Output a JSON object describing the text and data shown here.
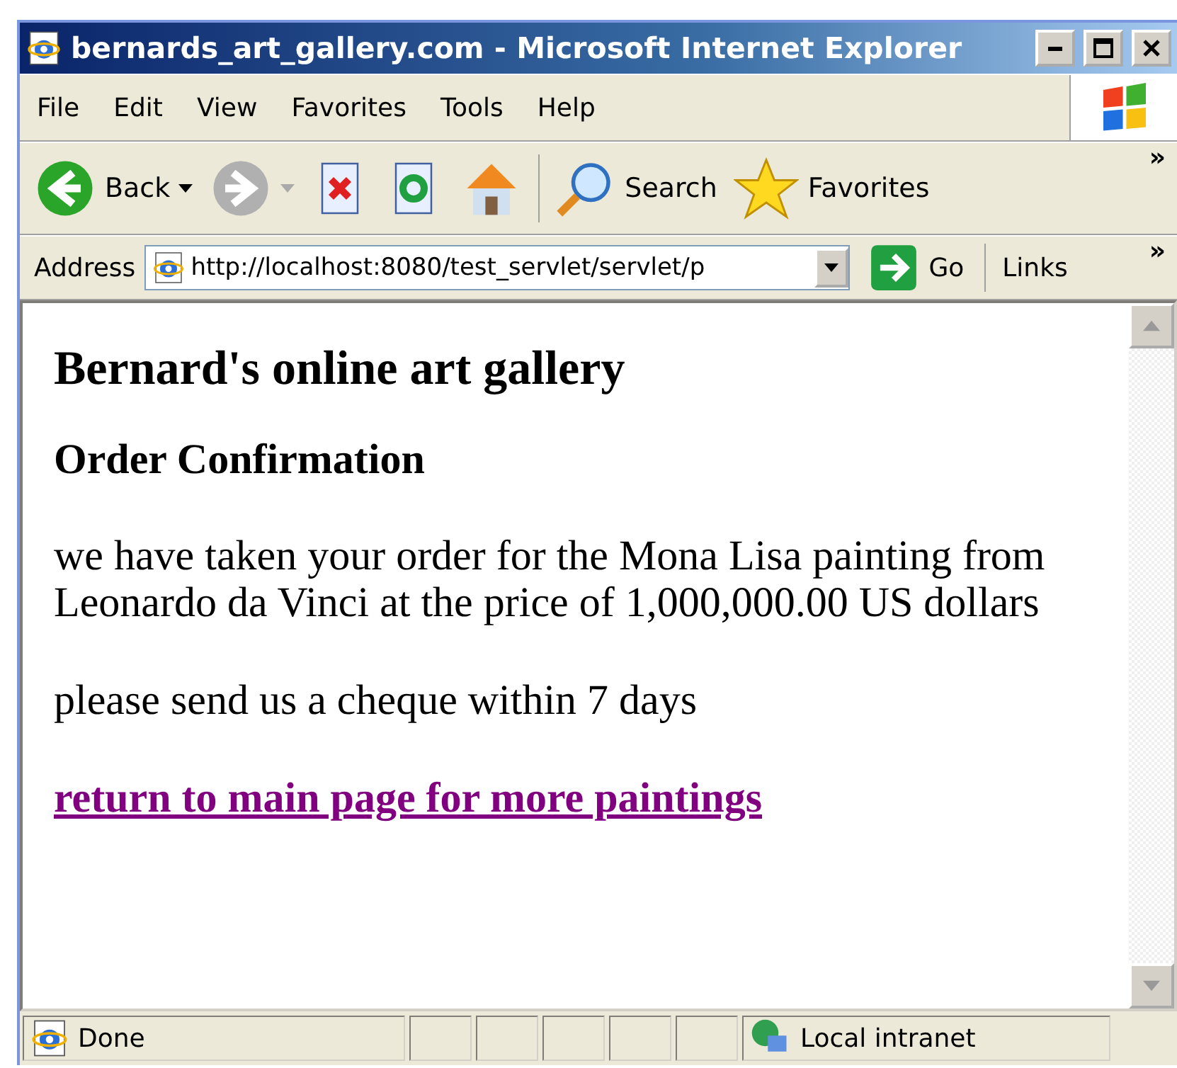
{
  "window": {
    "title": "bernards_art_gallery.com - Microsoft Internet Explorer"
  },
  "menu": [
    "File",
    "Edit",
    "View",
    "Favorites",
    "Tools",
    "Help"
  ],
  "toolbar": [
    {
      "kind": "back",
      "label": "Back",
      "disabled": false
    },
    {
      "kind": "forward",
      "disabled": true
    },
    {
      "kind": "stop",
      "disabled": false
    },
    {
      "kind": "refresh",
      "disabled": false
    },
    {
      "kind": "home",
      "disabled": false
    },
    {
      "kind": "search",
      "label": "Search",
      "disabled": false
    },
    {
      "kind": "favorites",
      "label": "Favorites",
      "disabled": false
    }
  ],
  "toolbar_more": "»",
  "address": {
    "label": "Address",
    "value": "http://localhost:8080/test_servlet/servlet/p",
    "go": "Go",
    "links": "Links",
    "links_more": "»"
  },
  "page": {
    "heading": "Bernard's online art gallery",
    "subheading": "Order Confirmation",
    "paragraphs": [
      "we have taken your order for the Mona Lisa painting from Leonardo da Vinci at the price of 1,000,000.00 US dollars",
      "please send us a cheque within 7 days"
    ],
    "link": {
      "text": "return to main page for more paintings",
      "visited": true
    }
  },
  "status_bar": {
    "status": "Done",
    "zone": "Local intranet"
  }
}
